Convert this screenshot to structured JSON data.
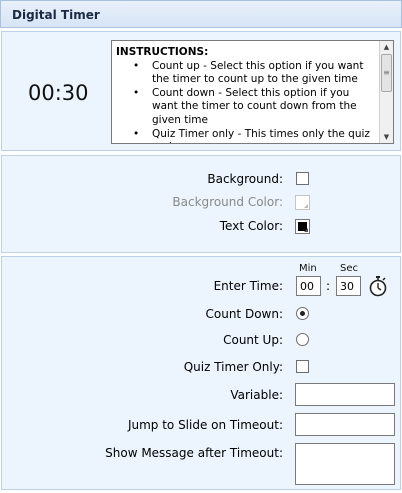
{
  "header": {
    "title": "Digital Timer"
  },
  "timer": {
    "display": "00:30"
  },
  "instructions": {
    "title": "INSTRUCTIONS:",
    "items": [
      "Count up - Select this option if you want the timer to count up to the given time",
      "Count down - Select this option if you want the timer to count down from the given time",
      "Quiz Timer only - This times only the quiz and"
    ]
  },
  "appearance": {
    "background_label": "Background:",
    "background_checked": false,
    "background_color_label": "Background Color:",
    "background_color_value": "#ffffff",
    "text_color_label": "Text Color:",
    "text_color_value": "#000000"
  },
  "settings": {
    "enter_time_label": "Enter Time:",
    "min_label": "Min",
    "sec_label": "Sec",
    "min_value": "00",
    "sec_value": "30",
    "colon": ":",
    "count_down_label": "Count Down:",
    "count_down_selected": true,
    "count_up_label": "Count Up:",
    "count_up_selected": false,
    "quiz_timer_only_label": "Quiz Timer Only:",
    "quiz_timer_only_checked": false,
    "variable_label": "Variable:",
    "variable_value": "",
    "jump_label": "Jump to Slide on Timeout:",
    "jump_value": "",
    "message_label": "Show Message after Timeout:",
    "message_value": ""
  },
  "icons": {
    "stopwatch": "stopwatch-icon",
    "scroll_up": "scroll-up-arrow-icon",
    "scroll_down": "scroll-down-arrow-icon",
    "dropdown": "dropdown-triangle-icon"
  }
}
